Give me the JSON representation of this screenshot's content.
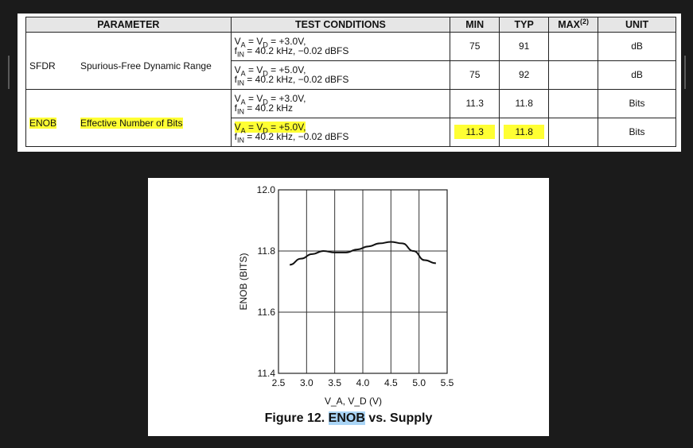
{
  "table": {
    "headers": {
      "parameter": "PARAMETER",
      "conditions": "TEST CONDITIONS",
      "min": "MIN",
      "typ": "TYP",
      "max": "MAX",
      "max_note": "(2)",
      "unit": "UNIT"
    },
    "rows": [
      {
        "symbol": "SFDR",
        "description": "Spurious-Free Dynamic Range",
        "cond1": "V_A = V_D = +3.0V,",
        "cond2": "f_IN = 40.2 kHz, −0.02 dBFS",
        "min": "75",
        "typ": "91",
        "max": "",
        "unit": "dB"
      },
      {
        "symbol": "",
        "description": "",
        "cond1": "V_A = V_D = +5.0V,",
        "cond2": "f_IN = 40.2 kHz, −0.02 dBFS",
        "min": "75",
        "typ": "92",
        "max": "",
        "unit": "dB"
      },
      {
        "symbol": "ENOB",
        "description": "Effective Number of Bits",
        "cond1": "V_A = V_D = +3.0V,",
        "cond2": "f_IN = 40.2 kHz",
        "min": "11.3",
        "typ": "11.8",
        "max": "",
        "unit": "Bits"
      },
      {
        "symbol": "",
        "description": "",
        "cond1": "V_A = V_D = +5.0V,",
        "cond2": "f_IN = 40.2 kHz, −0.02 dBFS",
        "min": "11.3",
        "typ": "11.8",
        "max": "",
        "unit": "Bits"
      }
    ],
    "highlight_color": "#ffff33"
  },
  "figure": {
    "caption_prefix": "Figure 12. ",
    "caption_highlight": "ENOB",
    "caption_suffix": " vs. Supply",
    "highlight_color": "#a9d4f5"
  },
  "chart_data": {
    "type": "line",
    "xlabel": "V_A, V_D (V)",
    "ylabel": "ENOB (BITS)",
    "xlim": [
      2.5,
      5.5
    ],
    "ylim": [
      11.4,
      12.0
    ],
    "x_ticks": [
      "2.5",
      "3.0",
      "3.5",
      "4.0",
      "4.5",
      "5.0",
      "5.5"
    ],
    "y_ticks": [
      "11.4",
      "11.6",
      "11.8",
      "12.0"
    ],
    "grid": true,
    "series": [
      {
        "x": [
          2.7,
          2.9,
          3.1,
          3.3,
          3.5,
          3.7,
          3.9,
          4.1,
          4.3,
          4.5,
          4.7,
          4.9,
          5.1,
          5.3
        ],
        "values": [
          11.755,
          11.775,
          11.79,
          11.8,
          11.795,
          11.795,
          11.805,
          11.815,
          11.825,
          11.83,
          11.825,
          11.8,
          11.77,
          11.76
        ]
      }
    ]
  }
}
